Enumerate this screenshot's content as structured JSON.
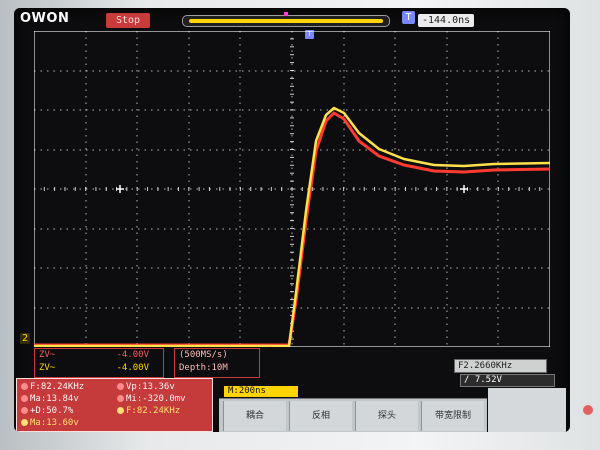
{
  "brand": "OWON",
  "status": "Stop",
  "trigger_marker": "T",
  "trigger_offset": "-144.0ns",
  "channel_marker": "2",
  "channels": [
    {
      "label": "ZV~",
      "value": "-4.00V"
    },
    {
      "label": "ZV~",
      "value": "-4.00V"
    }
  ],
  "sampling": {
    "rate": "(500MS/s)",
    "depth": "Depth:10M"
  },
  "frequency_badge": "F2.2660KHz",
  "trigger_setting": "/ 7.52V",
  "timebase": "M:200ns",
  "measurements": [
    {
      "text": "F:82.24KHz"
    },
    {
      "text": "Vp:13.36v"
    },
    {
      "text": "Ma:13.84v"
    },
    {
      "text": "Mi:-320.0mv"
    },
    {
      "text": "+D:50.7%"
    },
    {
      "text": "F:82.24KHz"
    },
    {
      "text": "Ma:13.60v"
    }
  ],
  "menu": [
    {
      "label": "耦合"
    },
    {
      "label": "反相"
    },
    {
      "label": "探头"
    },
    {
      "label": "带宽限制"
    }
  ],
  "colors": {
    "ch1": "#ff3b32",
    "ch2": "#ffd400",
    "grid": "#ffffff",
    "screen_bg": "#0d0d0f"
  }
}
